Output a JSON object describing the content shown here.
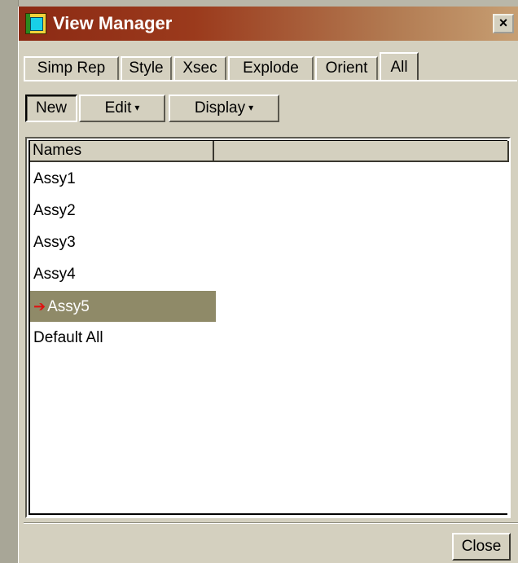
{
  "window": {
    "title": "View Manager",
    "close_glyph": "×"
  },
  "tabs": [
    {
      "label": "Simp Rep"
    },
    {
      "label": "Style"
    },
    {
      "label": "Xsec"
    },
    {
      "label": "Explode"
    },
    {
      "label": "Orient"
    },
    {
      "label": "All",
      "active": true
    }
  ],
  "toolbar": {
    "new_label": "New",
    "edit_label": "Edit",
    "display_label": "Display",
    "dropdown_glyph": "▾"
  },
  "list": {
    "column_headers": [
      "Names",
      ""
    ],
    "items": [
      {
        "label": "Assy1"
      },
      {
        "label": "Assy2"
      },
      {
        "label": "Assy3"
      },
      {
        "label": "Assy4"
      },
      {
        "label": "Assy5",
        "selected": true,
        "active_marker": "➔"
      },
      {
        "label": "Default All"
      }
    ]
  },
  "footer": {
    "close_label": "Close"
  },
  "colors": {
    "title_start": "#8c2a14",
    "title_end": "#c79f73",
    "selection_bg": "#8f8a68",
    "active_arrow": "#e01010"
  }
}
